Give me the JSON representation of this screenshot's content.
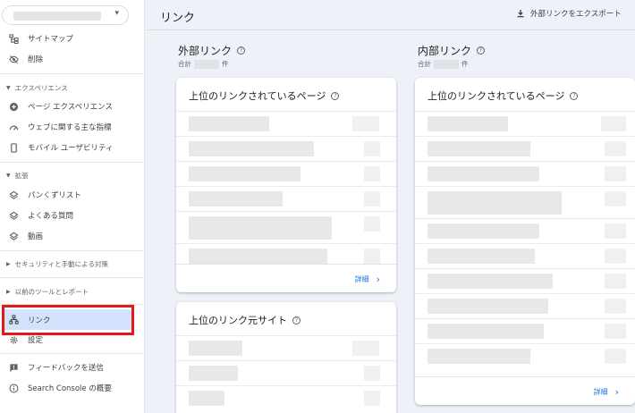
{
  "sidebar": {
    "property_caret": "▾",
    "items_top": [
      {
        "label": "サイトマップ",
        "icon": "sitemap-icon"
      },
      {
        "label": "削除",
        "icon": "eye-off-icon"
      }
    ],
    "section_experience": "エクスペリエンス",
    "items_experience": [
      {
        "label": "ページ エクスペリエンス",
        "icon": "plus-circle-icon"
      },
      {
        "label": "ウェブに関する主な指標",
        "icon": "speed-icon"
      },
      {
        "label": "モバイル ユーザビリティ",
        "icon": "phone-icon"
      }
    ],
    "section_enhancements": "拡張",
    "items_enhancements": [
      {
        "label": "パンくずリスト",
        "icon": "layers-icon"
      },
      {
        "label": "よくある質問",
        "icon": "layers-icon"
      },
      {
        "label": "動画",
        "icon": "layers-icon"
      }
    ],
    "section_security": "セキュリティと手動による対策",
    "section_legacy": "以前のツールとレポート",
    "items_bottom": [
      {
        "label": "リンク",
        "icon": "links-icon"
      },
      {
        "label": "設定",
        "icon": "gear-icon"
      }
    ],
    "items_footer": [
      {
        "label": "フィードバックを送信",
        "icon": "feedback-icon"
      },
      {
        "label": "Search Console の概要",
        "icon": "info-icon"
      }
    ]
  },
  "header": {
    "title": "リンク",
    "export_label": "外部リンクをエクスポート"
  },
  "external": {
    "title": "外部リンク",
    "total_prefix": "合計",
    "total_suffix": "件",
    "top_pages_title": "上位のリンクされているページ",
    "top_sites_title": "上位のリンク元サイト",
    "detail_label": "詳細"
  },
  "internal": {
    "title": "内部リンク",
    "total_prefix": "合計",
    "total_suffix": "件",
    "top_pages_title": "上位のリンクされているページ",
    "detail_label": "詳細"
  },
  "help_glyph": "?",
  "chevron_glyph": "›",
  "colors": {
    "accent": "#1a73e8",
    "active_bg": "#d3e3fd",
    "highlight": "#e01919",
    "page_bg": "#eef1f8"
  }
}
